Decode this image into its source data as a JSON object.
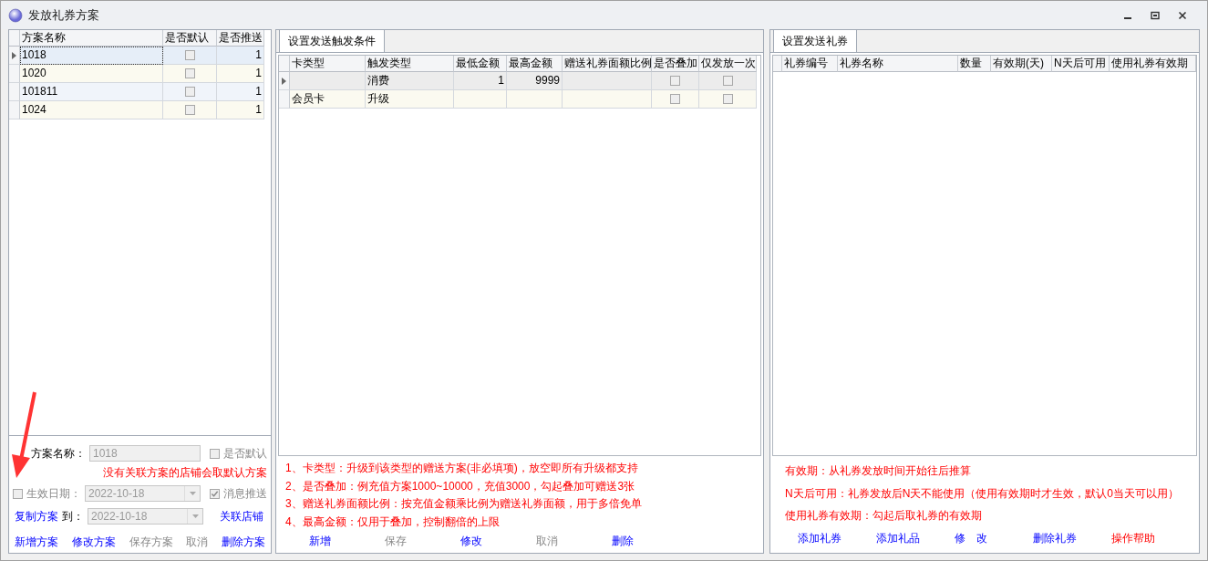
{
  "window": {
    "title": "发放礼券方案"
  },
  "plans": {
    "columns": [
      "方案名称",
      "是否默认",
      "是否推送"
    ],
    "rows": [
      {
        "name": "1018",
        "default": false,
        "push": "1",
        "selected": true
      },
      {
        "name": "1020",
        "default": false,
        "push": "1",
        "selected": false
      },
      {
        "name": "101811",
        "default": false,
        "push": "1",
        "selected": false
      },
      {
        "name": "1024",
        "default": false,
        "push": "1",
        "selected": false
      }
    ]
  },
  "plan_form": {
    "name_label": "方案名称：",
    "name_value": "1018",
    "default_check": {
      "label": "是否默认",
      "checked": false
    },
    "note": "没有关联方案的店铺会取默认方案",
    "date_check": {
      "label": "生效日期：",
      "checked": false
    },
    "date_value": "2022-10-18",
    "push_check": {
      "label": "消息推送",
      "checked": true
    },
    "copy_link": "复制方案",
    "to_label": "到：",
    "to_date": "2022-10-18",
    "link_stores": "关联店铺",
    "buttons": [
      {
        "label": "新增方案",
        "disabled": false
      },
      {
        "label": "修改方案",
        "disabled": false
      },
      {
        "label": "保存方案",
        "disabled": true
      },
      {
        "label": "取消",
        "disabled": true
      },
      {
        "label": "删除方案",
        "disabled": false
      }
    ]
  },
  "triggers": {
    "tab": {
      "label": "设置发送触发条件",
      "selected": true
    },
    "columns": [
      "卡类型",
      "触发类型",
      "最低金额",
      "最高金额",
      "赠送礼券面额比例",
      "是否叠加",
      "仅发放一次"
    ],
    "rows": [
      {
        "card_type": "",
        "trigger_type": "消费",
        "min": "1",
        "max": "9999",
        "ratio": "",
        "stack": false,
        "once": false,
        "selected": true
      },
      {
        "card_type": "会员卡",
        "trigger_type": "升级",
        "min": "",
        "max": "",
        "ratio": "",
        "stack": false,
        "once": false,
        "selected": false
      }
    ],
    "notes": [
      "1、卡类型：升级到该类型的赠送方案(非必填项)，放空即所有升级都支持",
      "2、是否叠加：例充值方案1000~10000，充值3000，勾起叠加可赠送3张",
      "3、赠送礼券面额比例：按充值金额乘比例为赠送礼券面额，用于多倍免单",
      "4、最高金额：仅用于叠加，控制翻倍的上限"
    ],
    "buttons": [
      {
        "label": "新增",
        "disabled": false
      },
      {
        "label": "保存",
        "disabled": true
      },
      {
        "label": "修改",
        "disabled": false
      },
      {
        "label": "取消",
        "disabled": true
      },
      {
        "label": "删除",
        "disabled": false
      }
    ]
  },
  "coupons": {
    "tab": {
      "label": "设置发送礼券",
      "selected": true
    },
    "columns": [
      "礼券编号",
      "礼券名称",
      "数量",
      "有效期(天)",
      "N天后可用",
      "使用礼券有效期"
    ],
    "notes": [
      "有效期：从礼券发放时间开始往后推算",
      "N天后可用：礼券发放后N天不能使用（使用有效期时才生效，默认0当天可以用）",
      "使用礼券有效期：勾起后取礼券的有效期"
    ],
    "buttons": [
      {
        "label": "添加礼券",
        "kind": "action"
      },
      {
        "label": "添加礼品",
        "kind": "action"
      },
      {
        "label": "修　改",
        "kind": "action"
      },
      {
        "label": "删除礼券",
        "kind": "action"
      },
      {
        "label": "操作帮助",
        "kind": "help"
      }
    ]
  }
}
